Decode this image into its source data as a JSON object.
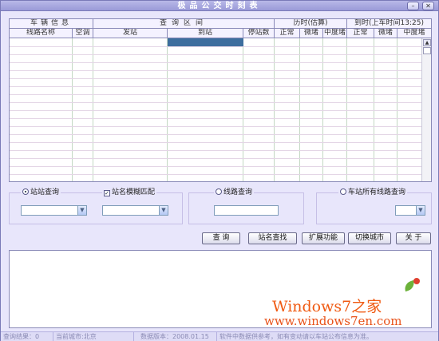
{
  "window": {
    "title": "极品公交时刻表",
    "minimize_icon": "minimize-icon",
    "close_icon": "close-icon"
  },
  "table": {
    "group_headers": [
      "车辆信息",
      "查询区间",
      "历时(估算)",
      "到时(上车时间13:25)"
    ],
    "columns": [
      "线路名称",
      "空调",
      "发站",
      "到站",
      "停站数",
      "正常",
      "微堵",
      "中度堵",
      "正常",
      "微堵",
      "中度堵"
    ],
    "rows": []
  },
  "query": {
    "station_query": "站站查询",
    "fuzzy_match": "站名模糊匹配",
    "line_query": "线路查询",
    "all_lines_query": "车站所有线路查询",
    "station_query_selected": true,
    "fuzzy_match_checked": true
  },
  "buttons": {
    "query": "查 询",
    "find_station": "站名查找",
    "extend": "扩展功能",
    "switch_city": "切换城市",
    "about": "关 于"
  },
  "watermark": {
    "line1": "Windows7之家",
    "line2": "www.windows7en.com"
  },
  "status": {
    "result": "查询结果：0",
    "city": "当前城市:北京",
    "version": "数据版本：2008.01.15",
    "note": "软件中数据供参考，如有变动请以车站公布信息为准。"
  }
}
